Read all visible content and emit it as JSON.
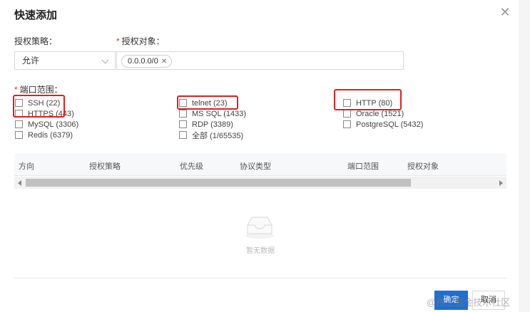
{
  "dialog": {
    "title": "快速添加"
  },
  "form": {
    "policy_label": "授权策略：",
    "policy_value": "允许",
    "target_label": "授权对象：",
    "target_tag": "0.0.0.0/0",
    "ports_label": "端口范围："
  },
  "ports": {
    "col1": [
      "SSH (22)",
      "HTTPS (443)",
      "MySQL (3306)",
      "Redis (6379)"
    ],
    "col2": [
      "telnet (23)",
      "MS SQL (1433)",
      "RDP (3389)",
      "全部 (1/65535)"
    ],
    "col3": [
      "HTTP (80)",
      "Oracle (1521)",
      "PostgreSQL (5432)"
    ]
  },
  "table": {
    "headers": [
      "方向",
      "授权策略",
      "优先级",
      "协议类型",
      "端口范围",
      "授权对象"
    ],
    "empty_text": "暂无数据"
  },
  "footer": {
    "ok_label": "确定",
    "cancel_label": "取消"
  },
  "watermark": "@稀土掘金技术社区",
  "colors": {
    "primary": "#1f6fd1",
    "highlight": "#e02020",
    "required": "#e0302f"
  }
}
